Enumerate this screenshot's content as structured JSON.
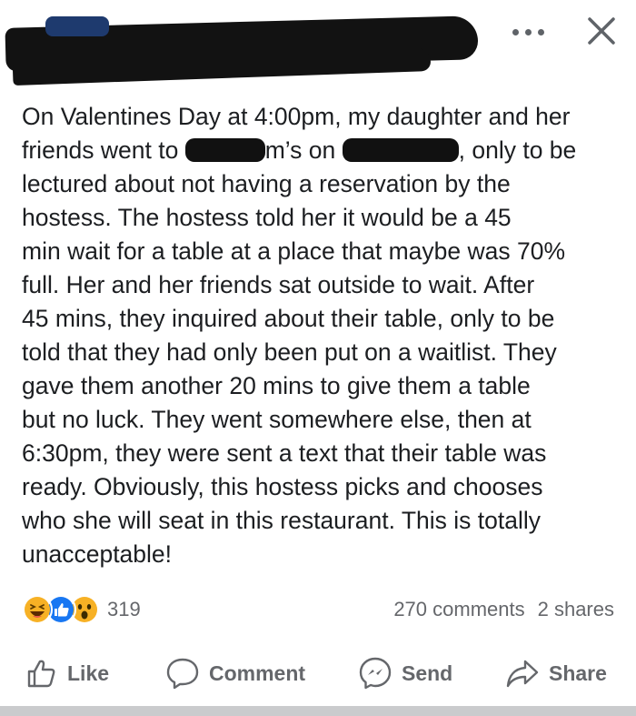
{
  "header": {
    "more_icon": "more-horizontal-icon",
    "close_icon": "close-icon"
  },
  "post": {
    "lines": [
      "On Valentines Day at 4:00pm, my daughter and her",
      [
        "friends went to ",
        "m’s on ",
        ", only to be"
      ],
      "lectured about not having a reservation by the",
      "hostess.  The hostess told her it would be a 45",
      "min wait for a table at a place that maybe was 70%",
      "full.  Her and her friends sat outside to wait.  After",
      "45 mins, they inquired about their table, only to be",
      "told that they had only been put on a waitlist.  They",
      "gave them another 20 mins to give them a table",
      "but no luck.  They went somewhere else, then at",
      "6:30pm, they were sent a text that their table was",
      "ready.  Obviously, this hostess picks and chooses",
      "who she will seat in this restaurant.  This is totally",
      "unacceptable!"
    ]
  },
  "reactions": {
    "count": "319",
    "icons": [
      "haha-emoji-icon",
      "like-thumb-icon",
      "wow-emoji-icon"
    ]
  },
  "stats": {
    "comments": "270 comments",
    "shares": "2 shares"
  },
  "actions": {
    "like": "Like",
    "comment": "Comment",
    "send": "Send",
    "share": "Share"
  },
  "colors": {
    "text": "#1c1e21",
    "muted": "#65676b",
    "like_blue": "#1877f2",
    "emoji_yellow": "#f7b125",
    "redaction": "#111111"
  }
}
